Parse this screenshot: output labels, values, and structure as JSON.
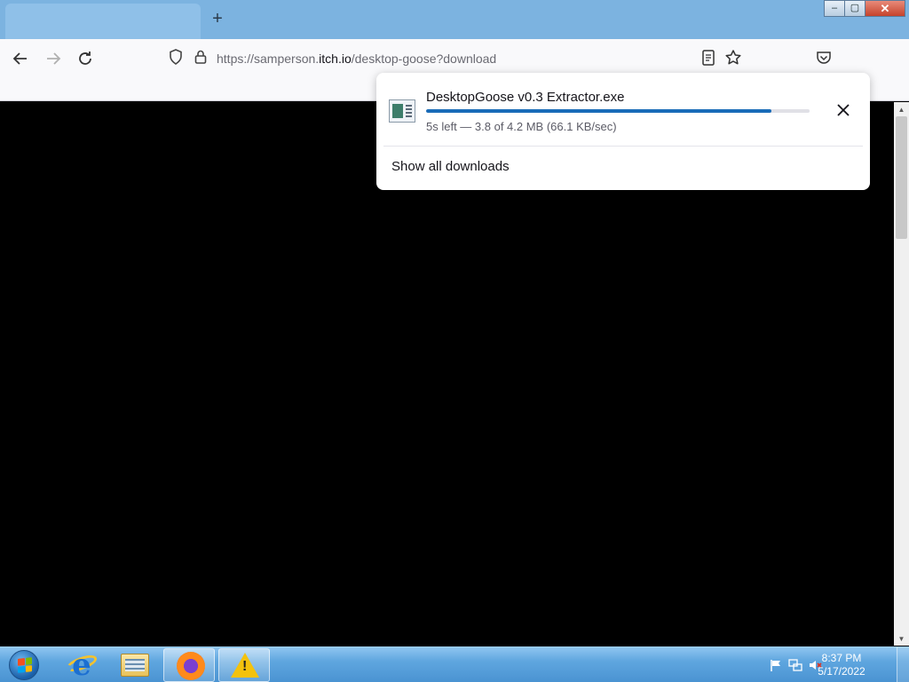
{
  "browser": {
    "new_tab_label": "+",
    "window_controls": {
      "minimize": "–",
      "maximize": "▢",
      "close": "✕"
    },
    "url": {
      "prefix": "https://samperson.",
      "domain": "itch.io",
      "path": "/desktop-goose?download"
    }
  },
  "downloads_panel": {
    "item": {
      "filename": "DesktopGoose v0.3 Extractor.exe",
      "status": "5s left — 3.8 of 4.2 MB (66.1 KB/sec)",
      "progress": 0.9,
      "cancel_label": "✕"
    },
    "show_all_label": "Show all downloads"
  },
  "taskbar": {
    "apps": [
      "internet-explorer",
      "file-explorer",
      "firefox",
      "warning"
    ],
    "clock": {
      "time": "8:37 PM",
      "date": "5/17/2022"
    }
  },
  "colors": {
    "accent": "#1a6cb8",
    "titlebar": "#7cb3e0",
    "page": "#000000"
  }
}
